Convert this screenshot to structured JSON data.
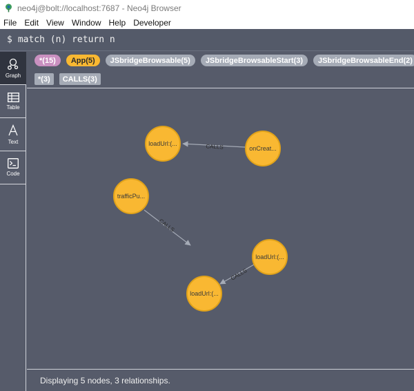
{
  "window": {
    "title": "neo4j@bolt://localhost:7687 - Neo4j Browser"
  },
  "menu": {
    "items": [
      "File",
      "Edit",
      "View",
      "Window",
      "Help",
      "Developer"
    ]
  },
  "command": {
    "prompt": "$",
    "query": "match (n) return n"
  },
  "sidebar": {
    "tabs": [
      {
        "label": "Graph",
        "icon": "graph-icon"
      },
      {
        "label": "Table",
        "icon": "table-icon"
      },
      {
        "label": "Text",
        "icon": "text-icon"
      },
      {
        "label": "Code",
        "icon": "code-icon"
      }
    ]
  },
  "legend": {
    "labels": [
      "*(15)",
      "App(5)",
      "JSbridgeBrowsable(5)",
      "JSbridgeBrowsableStart(3)",
      "JSbridgeBrowsableEnd(2)"
    ],
    "relationships": [
      "*(3)",
      "CALLS(3)"
    ]
  },
  "graph": {
    "nodes": [
      "loadUrl:(...",
      "onCreat...",
      "trafficPu...",
      "loadUrl:(...",
      "loadUrl:(..."
    ],
    "edge_label": "CALLS",
    "colors": {
      "node_fill": "#f9b832",
      "node_stroke": "#e0a21a",
      "edge": "#a5abb6",
      "background": "#565b6a"
    }
  },
  "status": {
    "text": "Displaying 5 nodes, 3 relationships."
  }
}
